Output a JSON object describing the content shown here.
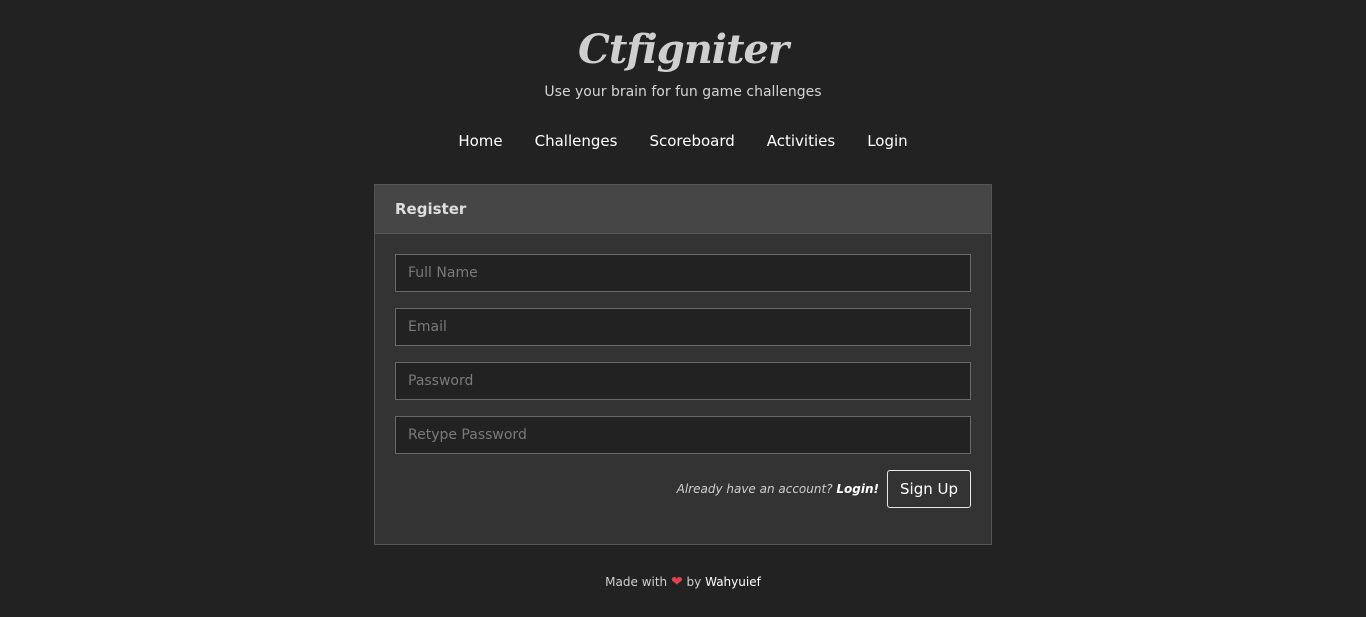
{
  "brand": {
    "title": "Ctfigniter",
    "tagline": "Use your brain for fun game challenges"
  },
  "nav": {
    "items": [
      "Home",
      "Challenges",
      "Scoreboard",
      "Activities",
      "Login"
    ]
  },
  "register": {
    "title": "Register",
    "fields": {
      "full_name_placeholder": "Full Name",
      "email_placeholder": "Email",
      "password_placeholder": "Password",
      "retype_password_placeholder": "Retype Password"
    },
    "hint_text": "Already have an account?",
    "login_link": "Login!",
    "submit_label": "Sign Up"
  },
  "footer": {
    "made_with": "Made with",
    "heart": "❤",
    "by": "by",
    "author": "Wahyuief"
  },
  "colors": {
    "background": "#222222",
    "panel": "#333333",
    "panel_header": "#464646",
    "heart": "#e0434b"
  }
}
